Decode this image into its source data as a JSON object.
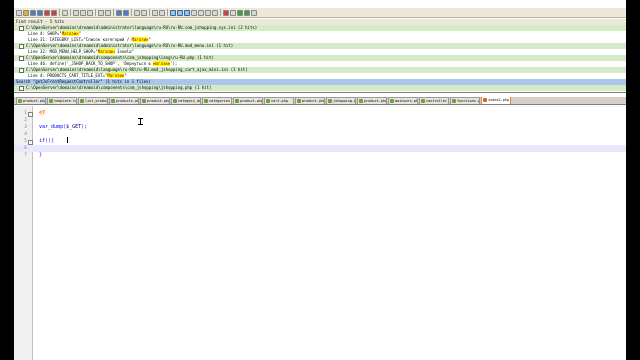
{
  "colors": {
    "file_row": "#d5ebc8",
    "search_row": "#a9c7ec",
    "highlight": "#ffff00",
    "active_tab_border": "#e08040"
  },
  "toolbar": {
    "icons": [
      "new-icon",
      "open-icon",
      "save-icon",
      "save-all-icon",
      "close-icon",
      "close-all-icon",
      "print-icon",
      "cut-icon",
      "copy-icon",
      "paste-icon",
      "undo-icon",
      "redo-icon",
      "find-icon",
      "replace-icon",
      "zoom-in-icon",
      "zoom-out-icon",
      "sync-v-icon",
      "sync-h-icon",
      "wrap-icon",
      "all-chars-icon",
      "indent-guide-icon",
      "udl-icon",
      "doc-map-icon",
      "function-list-icon",
      "monitor-icon",
      "record-icon",
      "stop-icon",
      "play-icon",
      "play-multi-icon",
      "save-macro-icon"
    ]
  },
  "find_panel": {
    "title": "Find result - 5 hits",
    "rows": [
      {
        "type": "file",
        "text": "C:\\OpenServer\\domains\\dreamoid\\administrator\\language\\ru-RU\\ru-RU.com_jshopping.sys.ini (2 hits)"
      },
      {
        "type": "hit",
        "pre": "Line 4: SHOP=\"",
        "hl": "Магазин",
        "post": "\""
      },
      {
        "type": "hit",
        "pre": "Line 31: CATEGORY_LIST=\"Список категорий / ",
        "hl": "Магазин",
        "post": "\""
      },
      {
        "type": "file",
        "text": "C:\\OpenServer\\domains\\dreamoid\\administrator\\language\\ru-RU\\ru-RU.mod_menu.ini (1 hit)"
      },
      {
        "type": "hit",
        "pre": "Line 32: MOD_MENU_HELP_SHOP=\"",
        "hl": "Магазин",
        "post": " Joomla\""
      },
      {
        "type": "file",
        "text": "C:\\OpenServer\\domains\\dreamoid\\components\\com_jshopping\\lang\\ru-RU.php (1 hit)"
      },
      {
        "type": "hit",
        "pre": "Line 46: define('_JSHOP_BACK_TO_SHOP', 'Вернуться в ",
        "hl": "магазин",
        "post": "');"
      },
      {
        "type": "file",
        "text": "C:\\OpenServer\\domains\\dreamoid\\language\\ru-RU\\ru-RU.mod_jshopping_cart_ajax_mini.ini (1 hit)"
      },
      {
        "type": "hit",
        "pre": "Line 4: PRODUCTS_CART_TITLE_EXT=\"",
        "hl": "Магазин",
        "post": "\""
      },
      {
        "type": "search",
        "text": "Search \"getJsFrontRequestController\" (1 hits in 1 files)"
      },
      {
        "type": "file",
        "text": "C:\\OpenServer\\domains\\dreamoid\\components\\com_jshopping\\jshopping.php (1 hit)"
      }
    ]
  },
  "tabs": [
    {
      "label": "product.php",
      "active": false
    },
    {
      "label": "template.tmpl.php",
      "active": false
    },
    {
      "label": "list_products.php",
      "active": false
    },
    {
      "label": "products.php",
      "active": false
    },
    {
      "label": "product.php",
      "active": false
    },
    {
      "label": "category_default.php",
      "active": false
    },
    {
      "label": "categories.php",
      "active": false
    },
    {
      "label": "product.php",
      "active": false
    },
    {
      "label": "cart.php",
      "active": false
    },
    {
      "label": "product.php",
      "active": false
    },
    {
      "label": "jshopping.php",
      "active": false
    },
    {
      "label": "product.php",
      "active": false
    },
    {
      "label": "mainvars.php",
      "active": false
    },
    {
      "label": "controller.php",
      "active": false
    },
    {
      "label": "functions.php",
      "active": false
    },
    {
      "label": "index2.php",
      "active": true
    }
  ],
  "editor": {
    "lines": [
      {
        "num": "1",
        "html_parts": [
          {
            "cls": "tag",
            "t": "<?"
          }
        ],
        "fold": "-"
      },
      {
        "num": "2",
        "html_parts": []
      },
      {
        "num": "3",
        "html_parts": [
          {
            "cls": "kw",
            "t": "var_dump"
          },
          {
            "cls": "br",
            "t": "("
          },
          {
            "cls": "",
            "t": "$_GET"
          },
          {
            "cls": "br",
            "t": ")"
          },
          {
            "cls": "",
            "t": ";"
          }
        ]
      },
      {
        "num": "4",
        "html_parts": []
      },
      {
        "num": "5",
        "html_parts": [
          {
            "cls": "kw",
            "t": "if"
          },
          {
            "cls": "br",
            "t": "(){"
          }
        ],
        "fold": "-"
      },
      {
        "num": "6",
        "html_parts": [],
        "current": true
      },
      {
        "num": "7",
        "html_parts": [
          {
            "cls": "br",
            "t": "}"
          }
        ]
      }
    ]
  }
}
